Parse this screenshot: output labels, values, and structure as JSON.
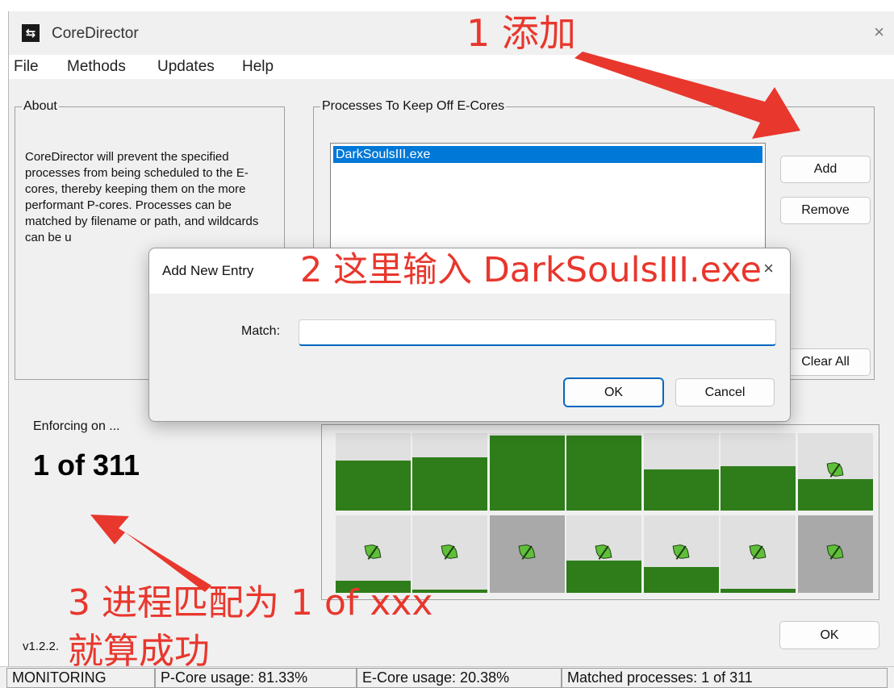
{
  "window": {
    "title": "CoreDirector",
    "close_glyph": "×"
  },
  "menu": [
    {
      "label": "File"
    },
    {
      "label": "Methods"
    },
    {
      "label": "Updates"
    },
    {
      "label": "Help"
    }
  ],
  "about": {
    "legend": "About",
    "text": "CoreDirector will prevent the specified processes from being scheduled to the E-cores, thereby keeping them on the more performant P-cores. Processes can be matched by filename or path, and wildcards can be u"
  },
  "processes": {
    "legend": "Processes To Keep Off E-Cores",
    "items": [
      "DarkSoulsIII.exe"
    ],
    "buttons": {
      "add": "Add",
      "remove": "Remove",
      "clear_all": "Clear All"
    }
  },
  "enforcing": {
    "label": "Enforcing on ...",
    "value": "1 of 311"
  },
  "cores": {
    "top_row": [
      {
        "usage": 0.65,
        "leaf": false,
        "dim": false
      },
      {
        "usage": 0.69,
        "leaf": false,
        "dim": false
      },
      {
        "usage": 0.97,
        "leaf": false,
        "dim": false
      },
      {
        "usage": 0.97,
        "leaf": false,
        "dim": false
      },
      {
        "usage": 0.53,
        "leaf": false,
        "dim": false
      },
      {
        "usage": 0.57,
        "leaf": false,
        "dim": false
      },
      {
        "usage": 0.41,
        "leaf": true,
        "dim": false
      }
    ],
    "bottom_row": [
      {
        "usage": 0.16,
        "leaf": true,
        "dim": false
      },
      {
        "usage": 0.04,
        "leaf": true,
        "dim": false
      },
      {
        "usage": 0.0,
        "leaf": true,
        "dim": true
      },
      {
        "usage": 0.42,
        "leaf": true,
        "dim": false
      },
      {
        "usage": 0.33,
        "leaf": true,
        "dim": false
      },
      {
        "usage": 0.05,
        "leaf": true,
        "dim": false
      },
      {
        "usage": 0.0,
        "leaf": true,
        "dim": true
      }
    ],
    "fill_color": "#2e7d1a",
    "leaf_icon": "green-leaf-icon"
  },
  "ok_label": "OK",
  "version": "v1.2.2.",
  "status": {
    "mode": "MONITORING",
    "p_core": "P-Core usage: 81.33%",
    "e_core": "E-Core usage: 20.38%",
    "matched": "Matched processes: 1 of 311"
  },
  "dialog": {
    "title": "Add New Entry",
    "close_glyph": "×",
    "match_label": "Match:",
    "match_value": "",
    "ok": "OK",
    "cancel": "Cancel"
  },
  "annotations": {
    "step1": "1 添加",
    "step2": "2 这里输入 DarkSoulsIII.exe",
    "step3_line1": "3 进程匹配为 1 of xxx",
    "step3_line2": "就算成功",
    "color": "#e8372d"
  }
}
